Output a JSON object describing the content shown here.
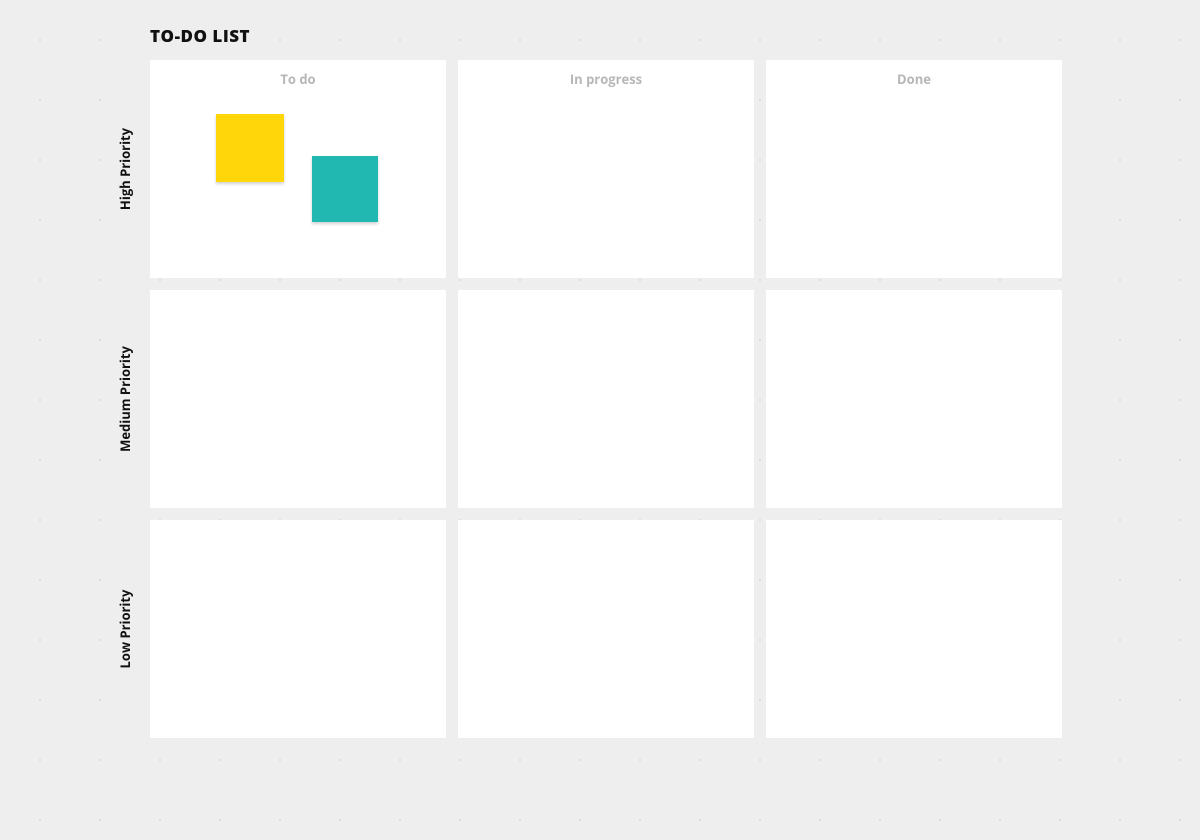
{
  "title": "TO-DO LIST",
  "columns": [
    "To do",
    "In progress",
    "Done"
  ],
  "rows": [
    "High Priority",
    "Medium Priority",
    "Low Priority"
  ],
  "stickies": [
    {
      "color": "#ffd60a",
      "cell": {
        "row": 0,
        "col": 0
      }
    },
    {
      "color": "#20b8b0",
      "cell": {
        "row": 0,
        "col": 0
      }
    }
  ]
}
